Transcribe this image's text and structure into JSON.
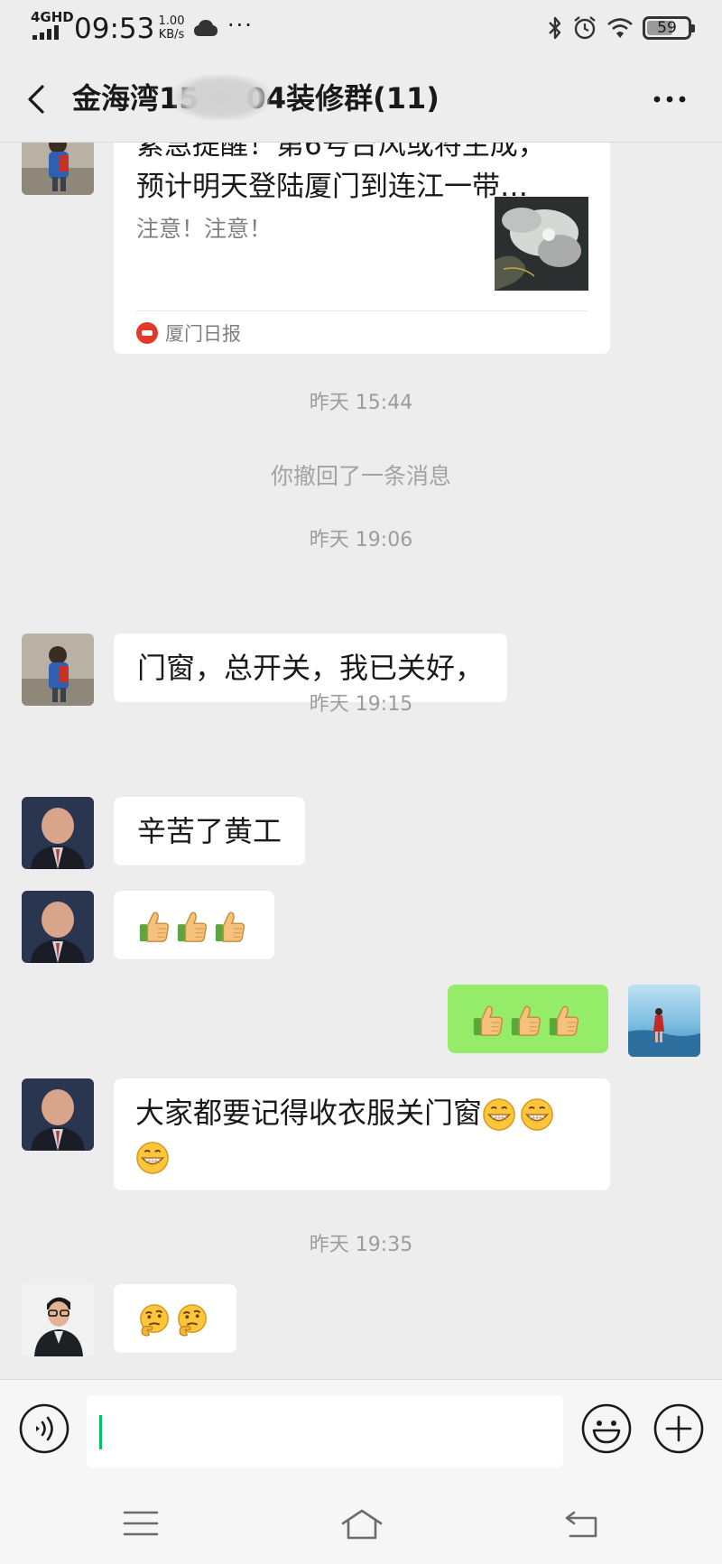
{
  "status_bar": {
    "network": "4GHD",
    "time": "09:53",
    "speed_value": "1.00",
    "speed_unit": "KB/s",
    "more": "···",
    "battery": "59",
    "battery_level": 0.59,
    "icons": [
      "signal-icon",
      "cloud-icon",
      "bluetooth-icon",
      "alarm-icon",
      "wifi-icon",
      "battery-icon"
    ]
  },
  "header": {
    "title_prefix": "金海湾15",
    "title_suffix": "04装修群(11)",
    "back_icon": "back-arrow-icon",
    "menu_icon": "more-icon"
  },
  "chat": {
    "card": {
      "title_line1": "紧急提醒！第6号台风或将生成，",
      "title_line2": "预计明天登陆厦门到连江一带…",
      "description": "注意！注意！",
      "source": "厦门日报"
    },
    "time1": "昨天 15:44",
    "recall": "你撤回了一条消息",
    "time2": "昨天 19:06",
    "msg1": "门窗，总开关，我已关好，",
    "time3": "昨天 19:15",
    "msg2": "辛苦了黄工",
    "msg3_emoji": [
      "thumbs-up",
      "thumbs-up",
      "thumbs-up"
    ],
    "msg4_emoji": [
      "thumbs-up",
      "thumbs-up",
      "thumbs-up"
    ],
    "msg5_text": "大家都要记得收衣服关门窗",
    "msg5_emoji": [
      "grin",
      "grin",
      "grin"
    ],
    "time4": "昨天 19:35",
    "msg6_emoji": [
      "thinking",
      "thinking"
    ]
  },
  "input_bar": {
    "text": "",
    "voice_icon": "voice-icon",
    "emoji_icon": "emoji-icon",
    "plus_icon": "plus-icon"
  },
  "nav_bar": {
    "icons": [
      "menu-icon",
      "home-icon",
      "back-nav-icon"
    ]
  },
  "colors": {
    "background": "#ededed",
    "my_bubble": "#95ec69",
    "bubble": "#ffffff",
    "accent": "#07c160"
  }
}
